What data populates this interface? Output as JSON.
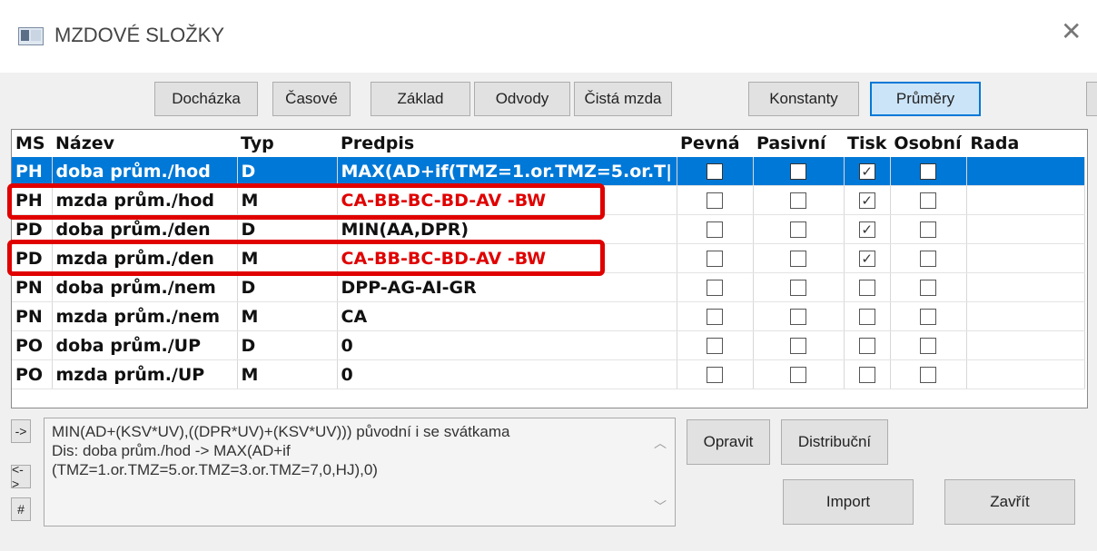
{
  "window": {
    "title": "MZDOVÉ SLOŽKY",
    "close_glyph": "✕"
  },
  "toolbar": {
    "dochazka": "Docházka",
    "casove": "Časové",
    "zaklad": "Základ",
    "odvody": "Odvody",
    "cista_mzda": "Čistá mzda",
    "konstanty": "Konstanty",
    "prumery": "Průměry"
  },
  "columns": {
    "ms": "MS",
    "nazev": "Název",
    "typ": "Typ",
    "predpis": "Predpis",
    "pevna": "Pevná",
    "pasivni": "Pasivní",
    "tisk": "Tisk",
    "osobni": "Osobní",
    "rada": "Rada"
  },
  "rows": [
    {
      "ms": "PH",
      "nazev": "doba prům./hod",
      "typ": "D",
      "predpis": "MAX(AD+if(TMZ=1.or.TMZ=5.or.T|",
      "pevna": false,
      "pasivni": false,
      "tisk": true,
      "osobni": false,
      "selected": true
    },
    {
      "ms": "PH",
      "nazev": "mzda prům./hod",
      "typ": "M",
      "predpis": "CA-BB-BC-BD-AV -BW",
      "pevna": false,
      "pasivni": false,
      "tisk": true,
      "osobni": false,
      "red": true
    },
    {
      "ms": "PD",
      "nazev": "doba prům./den",
      "typ": "D",
      "predpis": "MIN(AA,DPR)",
      "pevna": false,
      "pasivni": false,
      "tisk": true,
      "osobni": false
    },
    {
      "ms": "PD",
      "nazev": "mzda prům./den",
      "typ": "M",
      "predpis": "CA-BB-BC-BD-AV -BW",
      "pevna": false,
      "pasivni": false,
      "tisk": true,
      "osobni": false,
      "red": true
    },
    {
      "ms": "PN",
      "nazev": "doba prům./nem",
      "typ": "D",
      "predpis": "DPP-AG-AI-GR",
      "pevna": false,
      "pasivni": false,
      "tisk": false,
      "osobni": false
    },
    {
      "ms": "PN",
      "nazev": "mzda prům./nem",
      "typ": "M",
      "predpis": "CA",
      "pevna": false,
      "pasivni": false,
      "tisk": false,
      "osobni": false
    },
    {
      "ms": "PO",
      "nazev": "doba prům./UP",
      "typ": "D",
      "predpis": "0",
      "pevna": false,
      "pasivni": false,
      "tisk": false,
      "osobni": false
    },
    {
      "ms": "PO",
      "nazev": "mzda prům./UP",
      "typ": "M",
      "predpis": "0",
      "pevna": false,
      "pasivni": false,
      "tisk": false,
      "osobni": false
    }
  ],
  "side_buttons": {
    "arrow": "->",
    "swap": "<->",
    "hash": "#"
  },
  "notes": {
    "line1": "MIN(AD+(KSV*UV),((DPR*UV)+(KSV*UV))) původní i se svátkama",
    "line2": " Dis: doba prům./hod -> MAX(AD+if",
    "line3": "(TMZ=1.or.TMZ=5.or.TMZ=3.or.TMZ=7,0,HJ),0)"
  },
  "actions": {
    "opravit": "Opravit",
    "distribucni": "Distribuční",
    "import": "Import",
    "zavrit": "Zavřít"
  },
  "icons": {
    "window_icon": "app-window-icon",
    "checkmark": "☑"
  },
  "colors": {
    "selection": "#0078d7",
    "highlight": "#e00000",
    "formula_red": "#e00000"
  }
}
